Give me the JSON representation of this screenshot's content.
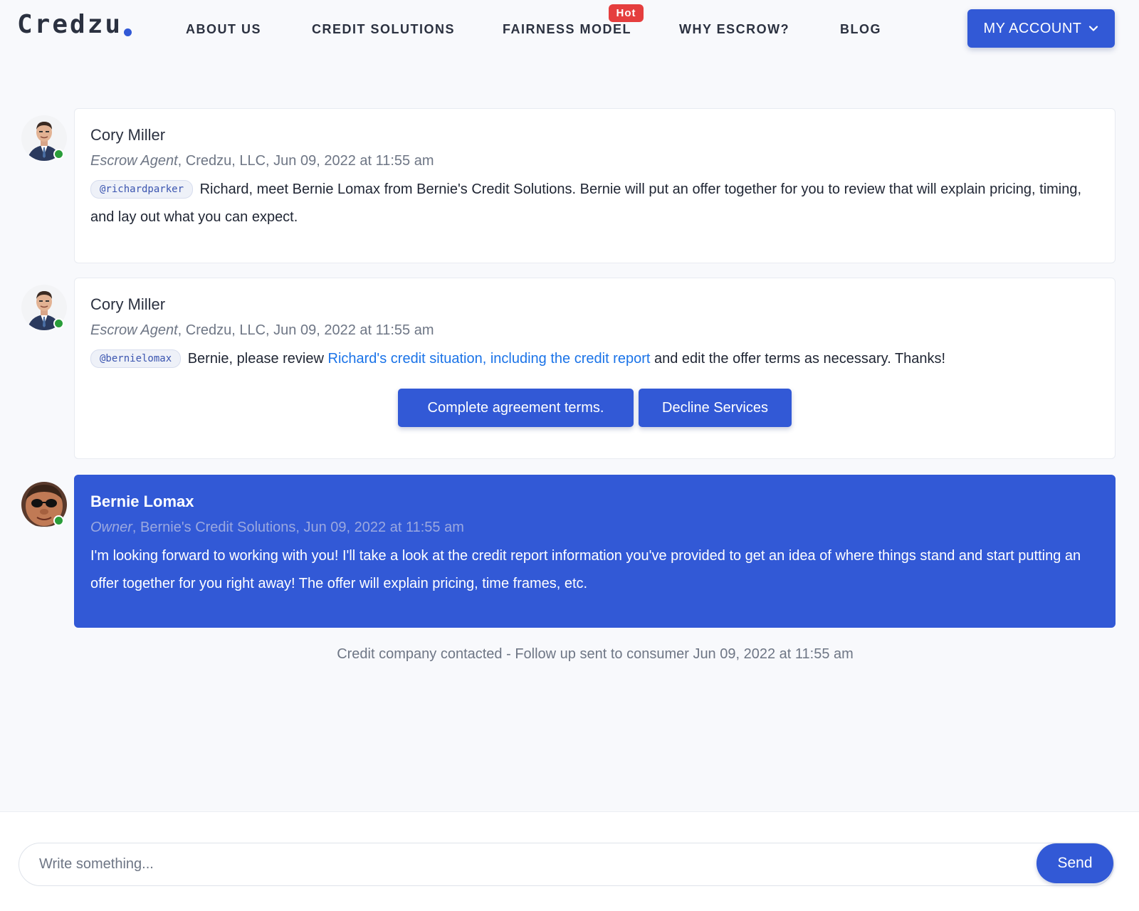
{
  "brand": {
    "name": "Credzu",
    "accent": "#3259d6"
  },
  "nav": {
    "items": [
      {
        "label": "ABOUT US"
      },
      {
        "label": "CREDIT SOLUTIONS"
      },
      {
        "label": "FAIRNESS MODEL",
        "badge": "Hot"
      },
      {
        "label": "WHY ESCROW?"
      },
      {
        "label": "BLOG"
      }
    ],
    "account_label": "MY ACCOUNT",
    "badge_color": "#e53e3e"
  },
  "messages": [
    {
      "author": "Cory Miller",
      "role": "Escrow Agent",
      "meta_rest": ", Credzu, LLC, Jun 09, 2022 at 11:55 am",
      "mention": "@richardparker",
      "text": "Richard, meet Bernie Lomax from Bernie's Credit Solutions. Bernie will put an offer together for you to review that will explain pricing, timing, and lay out what you can expect.",
      "online": true
    },
    {
      "author": "Cory Miller",
      "role": "Escrow Agent",
      "meta_rest": ", Credzu, LLC, Jun 09, 2022 at 11:55 am",
      "mention": "@bernielomax",
      "text_before": "Bernie, please review ",
      "link_text": "Richard's credit situation, including the credit report",
      "text_after": " and edit the offer terms as necessary. Thanks!",
      "buttons": [
        {
          "label": "Complete agreement terms."
        },
        {
          "label": "Decline Services"
        }
      ],
      "online": true
    },
    {
      "author": "Bernie Lomax",
      "role": "Owner",
      "meta_rest": ", Bernie's Credit Solutions, Jun 09, 2022 at 11:55 am",
      "text": "I'm looking forward to working with you! I'll take a look at the credit report information you've provided to get an idea of where things stand and start putting an offer together for you right away! The offer will explain pricing, time frames, etc.",
      "online": true,
      "highlight_color": "#3259d6"
    }
  ],
  "status_line": "Credit company contacted - Follow up sent to consumer Jun 09, 2022 at 11:55 am",
  "composer": {
    "placeholder": "Write something...",
    "value": "",
    "send_label": "Send"
  },
  "icons": {
    "online": "online-status-dot",
    "dropdown": "chevron-down-icon"
  },
  "colors": {
    "online": "#2a9d3a",
    "link": "#1a73e8"
  }
}
